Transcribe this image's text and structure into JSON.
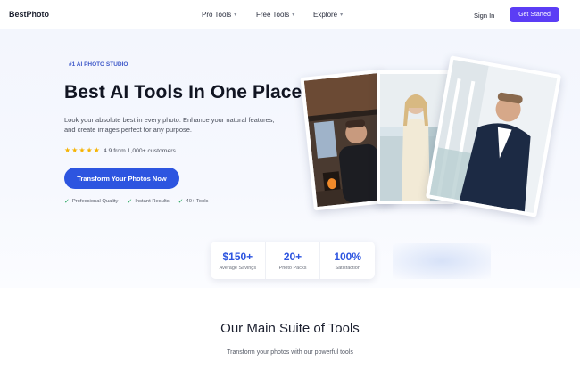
{
  "nav": {
    "brand": "BestPhoto",
    "items": [
      {
        "label": "Pro Tools"
      },
      {
        "label": "Free Tools"
      },
      {
        "label": "Explore"
      }
    ],
    "sign_in": "Sign In",
    "get_started": "Get Started"
  },
  "hero": {
    "eyebrow": "#1 AI PHOTO STUDIO",
    "title": "Best AI Tools In One Place",
    "subtitle": "Look your absolute best in every photo. Enhance your natural features, and create images perfect for any purpose.",
    "rating_text": "4.9 from 1,000+ customers",
    "star_count": 5,
    "cta": "Transform Your Photos Now",
    "features": [
      "Professional Quality",
      "Instant Results",
      "40+ Tools"
    ]
  },
  "stats": [
    {
      "value": "$150+",
      "label": "Average Savings"
    },
    {
      "value": "20+",
      "label": "Photo Packs"
    },
    {
      "value": "100%",
      "label": "Satisfaction"
    }
  ],
  "section": {
    "title": "Our Main Suite of Tools",
    "subtitle": "Transform your photos with our powerful tools"
  },
  "colors": {
    "accent_purple": "#5b3df5",
    "accent_blue": "#2d55e0",
    "star": "#f5b301",
    "check": "#23a55a"
  }
}
